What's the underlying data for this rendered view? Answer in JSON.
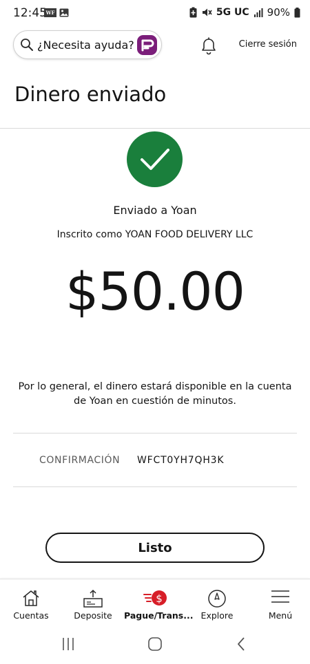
{
  "status_bar": {
    "time": "12:45",
    "network": "5G UC",
    "battery": "90%",
    "notification_icons": [
      "wells-fargo-badge-icon",
      "image-icon"
    ],
    "system_icons": [
      "battery-saver-icon",
      "mute-icon",
      "signal-icon",
      "battery-icon"
    ]
  },
  "header": {
    "search_placeholder": "¿Necesita ayuda?",
    "assistant_icon": "fargo-assistant-icon",
    "notifications_icon": "bell-icon",
    "signout_label": "Cierre sesión"
  },
  "page": {
    "title": "Dinero enviado"
  },
  "confirmation": {
    "status_icon": "checkmark-icon",
    "sent_to": "Enviado a Yoan",
    "enrolled_as": "Inscrito como YOAN FOOD DELIVERY LLC",
    "amount": "$50.00",
    "availability_message": "Por lo general, el dinero estará disponible en la cuenta de Yoan en cuestión de minutos.",
    "confirmation_label": "CONFIRMACIÓN",
    "confirmation_number": "WFCT0YH7QH3K",
    "done_label": "Listo"
  },
  "bottom_nav": {
    "items": [
      {
        "label": "Cuentas",
        "icon": "house-icon"
      },
      {
        "label": "Deposite",
        "icon": "deposit-icon"
      },
      {
        "label": "Pague/Trans...",
        "icon": "pay-transfer-icon",
        "active": true
      },
      {
        "label": "Explore",
        "icon": "compass-icon"
      },
      {
        "label": "Menú",
        "icon": "hamburger-menu-icon"
      }
    ]
  },
  "colors": {
    "success_green": "#1a7f3c",
    "brand_red": "#d71e28",
    "fargo_purple": "#7b1e7a",
    "text_primary": "#141414",
    "text_secondary": "#595959",
    "divider": "#d9d9d9"
  }
}
